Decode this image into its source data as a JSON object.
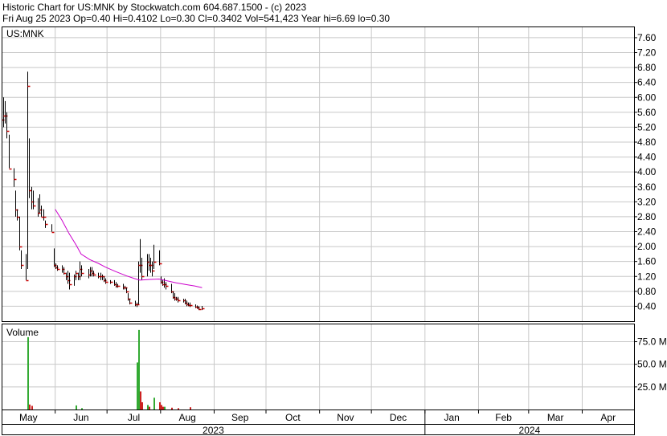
{
  "header": {
    "line1": "Historic Chart for US:MNK by Stockwatch.com 604.687.1500 - (c) 2023",
    "line2": "Fri Aug 25 2023  Op=0.40  Hi=0.4102  Lo=0.30  Cl=0.3402  Vol=541,423  Year hi=6.69  lo=0.30"
  },
  "colors": {
    "background": "#ffffff",
    "grid": "#c8c8c8",
    "price_bar": "#000000",
    "close_tick": "#cc0000",
    "moving_average": "#cc00cc",
    "volume_up": "#33aa33",
    "volume_down": "#cc2222"
  },
  "chart_data": [
    {
      "type": "ohlc",
      "title": "US:MNK",
      "ylabel": "",
      "ylim": [
        0,
        7.9
      ],
      "yticks": [
        "7.60",
        "7.20",
        "6.80",
        "6.40",
        "6.00",
        "5.60",
        "5.20",
        "4.80",
        "4.40",
        "4.00",
        "3.60",
        "3.20",
        "2.80",
        "2.40",
        "2.00",
        "1.60",
        "1.20",
        "0.80",
        "0.40"
      ],
      "x_months": [
        "May",
        "Jun",
        "Jul",
        "Aug",
        "Sep",
        "Oct",
        "Nov",
        "Dec",
        "Jan",
        "Feb",
        "Mar",
        "Apr"
      ],
      "x_years": [
        "2023",
        "2024"
      ],
      "grid": true,
      "bars": [
        {
          "date": "2023-05-01",
          "h": 6.0,
          "l": 5.3,
          "c": 5.4
        },
        {
          "date": "2023-05-02",
          "h": 6.0,
          "l": 5.2,
          "c": 5.5
        },
        {
          "date": "2023-05-03",
          "h": 5.9,
          "l": 5.3,
          "c": 5.5
        },
        {
          "date": "2023-05-04",
          "h": 5.6,
          "l": 4.9,
          "c": 5.1
        },
        {
          "date": "2023-05-05",
          "h": 5.0,
          "l": 4.1,
          "c": 4.1
        },
        {
          "date": "2023-05-08",
          "h": 4.1,
          "l": 3.6,
          "c": 3.8
        },
        {
          "date": "2023-05-09",
          "h": 3.5,
          "l": 2.8,
          "c": 3.0
        },
        {
          "date": "2023-05-10",
          "h": 3.0,
          "l": 2.7,
          "c": 2.8
        },
        {
          "date": "2023-05-11",
          "h": 2.8,
          "l": 1.9,
          "c": 2.0
        },
        {
          "date": "2023-05-12",
          "h": 1.9,
          "l": 1.4,
          "c": 1.5
        },
        {
          "date": "2023-05-15",
          "h": 1.8,
          "l": 1.1,
          "c": 1.1
        },
        {
          "date": "2023-05-16",
          "h": 6.69,
          "l": 1.4,
          "c": 6.3
        },
        {
          "date": "2023-05-17",
          "h": 4.9,
          "l": 3.3,
          "c": 3.5
        },
        {
          "date": "2023-05-18",
          "h": 3.6,
          "l": 3.0,
          "c": 3.2
        },
        {
          "date": "2023-05-19",
          "h": 3.5,
          "l": 3.0,
          "c": 3.1
        },
        {
          "date": "2023-05-22",
          "h": 3.3,
          "l": 2.8,
          "c": 2.9
        },
        {
          "date": "2023-05-23",
          "h": 3.4,
          "l": 2.9,
          "c": 3.0
        },
        {
          "date": "2023-05-24",
          "h": 3.1,
          "l": 2.8,
          "c": 2.8
        },
        {
          "date": "2023-05-25",
          "h": 3.0,
          "l": 2.7,
          "c": 2.8
        },
        {
          "date": "2023-05-26",
          "h": 2.7,
          "l": 2.5,
          "c": 2.6
        },
        {
          "date": "2023-05-30",
          "h": 2.6,
          "l": 2.4,
          "c": 2.4
        },
        {
          "date": "2023-05-31",
          "h": 1.95,
          "l": 1.45,
          "c": 1.5
        },
        {
          "date": "2023-06-01",
          "h": 1.55,
          "l": 1.4,
          "c": 1.45
        },
        {
          "date": "2023-06-02",
          "h": 1.5,
          "l": 1.35,
          "c": 1.4
        },
        {
          "date": "2023-06-05",
          "h": 1.5,
          "l": 1.3,
          "c": 1.4
        },
        {
          "date": "2023-06-06",
          "h": 1.45,
          "l": 1.25,
          "c": 1.3
        },
        {
          "date": "2023-06-07",
          "h": 1.3,
          "l": 1.1,
          "c": 1.2
        },
        {
          "date": "2023-06-08",
          "h": 1.35,
          "l": 1.0,
          "c": 1.1
        },
        {
          "date": "2023-06-09",
          "h": 1.3,
          "l": 0.85,
          "c": 1.0
        },
        {
          "date": "2023-06-12",
          "h": 1.25,
          "l": 0.95,
          "c": 1.2
        },
        {
          "date": "2023-06-13",
          "h": 1.35,
          "l": 1.1,
          "c": 1.3
        },
        {
          "date": "2023-06-14",
          "h": 1.3,
          "l": 1.1,
          "c": 1.2
        },
        {
          "date": "2023-06-15",
          "h": 1.6,
          "l": 1.1,
          "c": 1.4
        },
        {
          "date": "2023-06-16",
          "h": 1.5,
          "l": 1.2,
          "c": 1.3
        },
        {
          "date": "2023-06-20",
          "h": 1.4,
          "l": 1.15,
          "c": 1.25
        },
        {
          "date": "2023-06-21",
          "h": 1.45,
          "l": 1.2,
          "c": 1.35
        },
        {
          "date": "2023-06-22",
          "h": 1.45,
          "l": 1.2,
          "c": 1.3
        },
        {
          "date": "2023-06-23",
          "h": 1.35,
          "l": 1.2,
          "c": 1.25
        },
        {
          "date": "2023-06-26",
          "h": 1.3,
          "l": 1.15,
          "c": 1.2
        },
        {
          "date": "2023-06-27",
          "h": 1.3,
          "l": 1.1,
          "c": 1.2
        },
        {
          "date": "2023-06-28",
          "h": 1.25,
          "l": 1.1,
          "c": 1.2
        },
        {
          "date": "2023-06-29",
          "h": 1.2,
          "l": 1.05,
          "c": 1.1
        },
        {
          "date": "2023-06-30",
          "h": 1.15,
          "l": 1.0,
          "c": 1.05
        },
        {
          "date": "2023-07-03",
          "h": 1.1,
          "l": 1.0,
          "c": 1.05
        },
        {
          "date": "2023-07-05",
          "h": 1.1,
          "l": 0.95,
          "c": 1.0
        },
        {
          "date": "2023-07-06",
          "h": 1.05,
          "l": 0.9,
          "c": 0.95
        },
        {
          "date": "2023-07-07",
          "h": 1.0,
          "l": 0.9,
          "c": 0.95
        },
        {
          "date": "2023-07-10",
          "h": 1.0,
          "l": 0.85,
          "c": 0.9
        },
        {
          "date": "2023-07-11",
          "h": 0.95,
          "l": 0.85,
          "c": 0.9
        },
        {
          "date": "2023-07-12",
          "h": 0.9,
          "l": 0.75,
          "c": 0.8
        },
        {
          "date": "2023-07-13",
          "h": 0.75,
          "l": 0.55,
          "c": 0.6
        },
        {
          "date": "2023-07-14",
          "h": 0.6,
          "l": 0.45,
          "c": 0.5
        },
        {
          "date": "2023-07-17",
          "h": 0.55,
          "l": 0.4,
          "c": 0.45
        },
        {
          "date": "2023-07-18",
          "h": 0.5,
          "l": 0.38,
          "c": 0.45
        },
        {
          "date": "2023-07-19",
          "h": 1.6,
          "l": 0.45,
          "c": 1.5
        },
        {
          "date": "2023-07-20",
          "h": 2.2,
          "l": 1.3,
          "c": 1.5
        },
        {
          "date": "2023-07-21",
          "h": 1.7,
          "l": 1.1,
          "c": 1.2
        },
        {
          "date": "2023-07-24",
          "h": 1.8,
          "l": 1.2,
          "c": 1.6
        },
        {
          "date": "2023-07-25",
          "h": 1.8,
          "l": 1.35,
          "c": 1.5
        },
        {
          "date": "2023-07-26",
          "h": 1.7,
          "l": 1.3,
          "c": 1.5
        },
        {
          "date": "2023-07-27",
          "h": 1.6,
          "l": 1.2,
          "c": 1.35
        },
        {
          "date": "2023-07-28",
          "h": 2.05,
          "l": 1.4,
          "c": 1.6
        },
        {
          "date": "2023-07-31",
          "h": 1.9,
          "l": 1.5,
          "c": 1.55
        },
        {
          "date": "2023-08-01",
          "h": 1.2,
          "l": 1.0,
          "c": 1.05
        },
        {
          "date": "2023-08-02",
          "h": 1.1,
          "l": 0.95,
          "c": 1.0
        },
        {
          "date": "2023-08-03",
          "h": 1.15,
          "l": 0.9,
          "c": 1.0
        },
        {
          "date": "2023-08-04",
          "h": 1.05,
          "l": 0.85,
          "c": 0.95
        },
        {
          "date": "2023-08-07",
          "h": 1.0,
          "l": 0.75,
          "c": 0.8
        },
        {
          "date": "2023-08-08",
          "h": 0.8,
          "l": 0.6,
          "c": 0.65
        },
        {
          "date": "2023-08-09",
          "h": 0.75,
          "l": 0.55,
          "c": 0.6
        },
        {
          "date": "2023-08-10",
          "h": 0.65,
          "l": 0.55,
          "c": 0.6
        },
        {
          "date": "2023-08-11",
          "h": 0.65,
          "l": 0.5,
          "c": 0.55
        },
        {
          "date": "2023-08-14",
          "h": 0.6,
          "l": 0.5,
          "c": 0.55
        },
        {
          "date": "2023-08-15",
          "h": 0.6,
          "l": 0.45,
          "c": 0.5
        },
        {
          "date": "2023-08-16",
          "h": 0.55,
          "l": 0.4,
          "c": 0.45
        },
        {
          "date": "2023-08-17",
          "h": 0.5,
          "l": 0.4,
          "c": 0.42
        },
        {
          "date": "2023-08-18",
          "h": 0.5,
          "l": 0.38,
          "c": 0.42
        },
        {
          "date": "2023-08-21",
          "h": 0.45,
          "l": 0.35,
          "c": 0.38
        },
        {
          "date": "2023-08-22",
          "h": 0.42,
          "l": 0.33,
          "c": 0.36
        },
        {
          "date": "2023-08-23",
          "h": 0.4,
          "l": 0.3,
          "c": 0.33
        },
        {
          "date": "2023-08-25",
          "h": 0.4102,
          "l": 0.3,
          "c": 0.3402
        }
      ],
      "moving_average": [
        {
          "date": "2023-06-01",
          "v": 3.0
        },
        {
          "date": "2023-06-05",
          "v": 2.7
        },
        {
          "date": "2023-06-09",
          "v": 2.35
        },
        {
          "date": "2023-06-13",
          "v": 2.05
        },
        {
          "date": "2023-06-16",
          "v": 1.8
        },
        {
          "date": "2023-06-21",
          "v": 1.65
        },
        {
          "date": "2023-06-26",
          "v": 1.55
        },
        {
          "date": "2023-06-30",
          "v": 1.45
        },
        {
          "date": "2023-07-06",
          "v": 1.33
        },
        {
          "date": "2023-07-12",
          "v": 1.22
        },
        {
          "date": "2023-07-17",
          "v": 1.14
        },
        {
          "date": "2023-07-20",
          "v": 1.1
        },
        {
          "date": "2023-07-26",
          "v": 1.12
        },
        {
          "date": "2023-07-31",
          "v": 1.13
        },
        {
          "date": "2023-08-04",
          "v": 1.09
        },
        {
          "date": "2023-08-10",
          "v": 1.03
        },
        {
          "date": "2023-08-16",
          "v": 0.98
        },
        {
          "date": "2023-08-21",
          "v": 0.94
        },
        {
          "date": "2023-08-25",
          "v": 0.9
        }
      ]
    },
    {
      "type": "bar",
      "title": "Volume",
      "ylabel": "",
      "ylim": [
        0,
        95000000
      ],
      "yticks": [
        "75.0 M",
        "50.0 M",
        "25.0 M"
      ],
      "bars": [
        {
          "date": "2023-05-16",
          "v": 80000000,
          "up": true
        },
        {
          "date": "2023-05-17",
          "v": 5500000,
          "up": false
        },
        {
          "date": "2023-05-18",
          "v": 4000000,
          "up": false
        },
        {
          "date": "2023-06-13",
          "v": 4500000,
          "up": true
        },
        {
          "date": "2023-06-16",
          "v": 1500000,
          "up": true
        },
        {
          "date": "2023-07-18",
          "v": 52000000,
          "up": true
        },
        {
          "date": "2023-07-19",
          "v": 88000000,
          "up": true
        },
        {
          "date": "2023-07-20",
          "v": 20000000,
          "up": false
        },
        {
          "date": "2023-07-21",
          "v": 8000000,
          "up": false
        },
        {
          "date": "2023-07-24",
          "v": 5000000,
          "up": true
        },
        {
          "date": "2023-07-25",
          "v": 3000000,
          "up": false
        },
        {
          "date": "2023-07-28",
          "v": 13000000,
          "up": true
        },
        {
          "date": "2023-07-31",
          "v": 8000000,
          "up": false
        },
        {
          "date": "2023-08-01",
          "v": 5000000,
          "up": false
        },
        {
          "date": "2023-08-02",
          "v": 3000000,
          "up": false
        },
        {
          "date": "2023-08-03",
          "v": 3000000,
          "up": true
        },
        {
          "date": "2023-08-07",
          "v": 2000000,
          "up": false
        },
        {
          "date": "2023-08-11",
          "v": 1500000,
          "up": false
        },
        {
          "date": "2023-08-18",
          "v": 2500000,
          "up": false
        }
      ]
    }
  ]
}
